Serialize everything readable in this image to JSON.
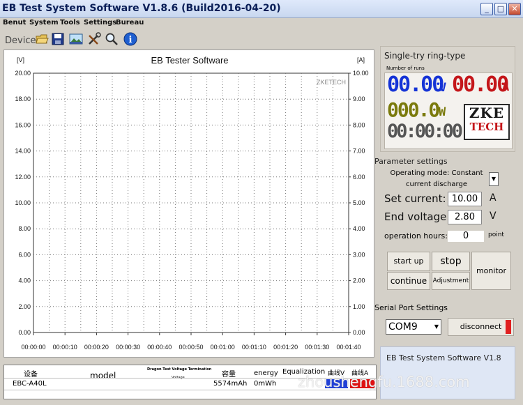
{
  "window": {
    "title": "EB Test System Software V1.8.6 (Build2016-04-20)"
  },
  "menu": [
    "Benut",
    "System",
    "Tools",
    "Settings",
    "Bureau"
  ],
  "toolbar": {
    "device_label": "Device 1",
    "icons": [
      "open-folder-icon",
      "save-icon",
      "picture-icon",
      "tools-icon",
      "search-icon",
      "info-icon"
    ]
  },
  "chart_data": {
    "type": "line",
    "title": "EB Tester Software",
    "left_axis_unit": "[V]",
    "right_axis_unit": "[A]",
    "y_left_ticks": [
      "20.00",
      "18.00",
      "16.00",
      "14.00",
      "12.00",
      "10.00",
      "8.00",
      "6.00",
      "4.00",
      "2.00",
      "0.00"
    ],
    "y_right_ticks": [
      "10.00",
      "9.00",
      "8.00",
      "7.00",
      "6.00",
      "5.00",
      "4.00",
      "3.00",
      "2.00",
      "1.00",
      "0.00"
    ],
    "x_ticks": [
      "00:00:00",
      "00:00:10",
      "00:00:20",
      "00:00:30",
      "00:00:40",
      "00:00:50",
      "00:01:00",
      "00:01:10",
      "00:01:20",
      "00:01:30",
      "00:01:40"
    ],
    "ylim_left": [
      0,
      20
    ],
    "ylim_right": [
      0,
      10
    ],
    "grid": true,
    "watermark": "ZKETECH",
    "series": []
  },
  "table": {
    "headers": [
      "设备",
      "model",
      "Dragon Test Voltage Termination",
      "Voltage",
      "容量",
      "energy",
      "Equalization",
      "曲线V",
      "曲线A"
    ],
    "row": {
      "device": "EBC-A40L",
      "capacity": "5574mAh",
      "energy": "0mWh"
    },
    "series_colors": {
      "curve_v": "#1f3fd8",
      "curve_a": "#e01010"
    }
  },
  "mode": {
    "title": "Single-try ring-type",
    "runs_label": "Number of runs",
    "voltage": "00.00",
    "voltage_unit": "V",
    "current": "00.00",
    "current_unit": "A",
    "power": "000.0",
    "power_unit": "W",
    "time": "00:00:00",
    "logo_top": "ZKE",
    "logo_bottom": "TECH",
    "colors": {
      "voltage": "#1533d6",
      "current": "#c4161a",
      "power": "#7a7a0c",
      "time": "#555555"
    }
  },
  "params": {
    "title": "Parameter settings",
    "mode_label": "Operating mode: Constant current discharge",
    "set_current_label": "Set current:",
    "set_current_value": "10.00",
    "set_current_unit": "A",
    "end_voltage_label": "End voltage:",
    "end_voltage_value": "2.80",
    "end_voltage_unit": "V",
    "hours_label": "operation hours:",
    "hours_value": "0",
    "hours_unit": "point",
    "buttons": {
      "start": "start up",
      "stop": "stop",
      "monitor": "monitor",
      "continue": "continue",
      "adjust": "Adjustment"
    }
  },
  "serial": {
    "title": "Serial Port Settings",
    "port": "COM9",
    "disconnect": "disconnect"
  },
  "footer": {
    "app_name": "EB Test System Software V1.8",
    "watermark": "zhoushengfu.1688.com"
  }
}
